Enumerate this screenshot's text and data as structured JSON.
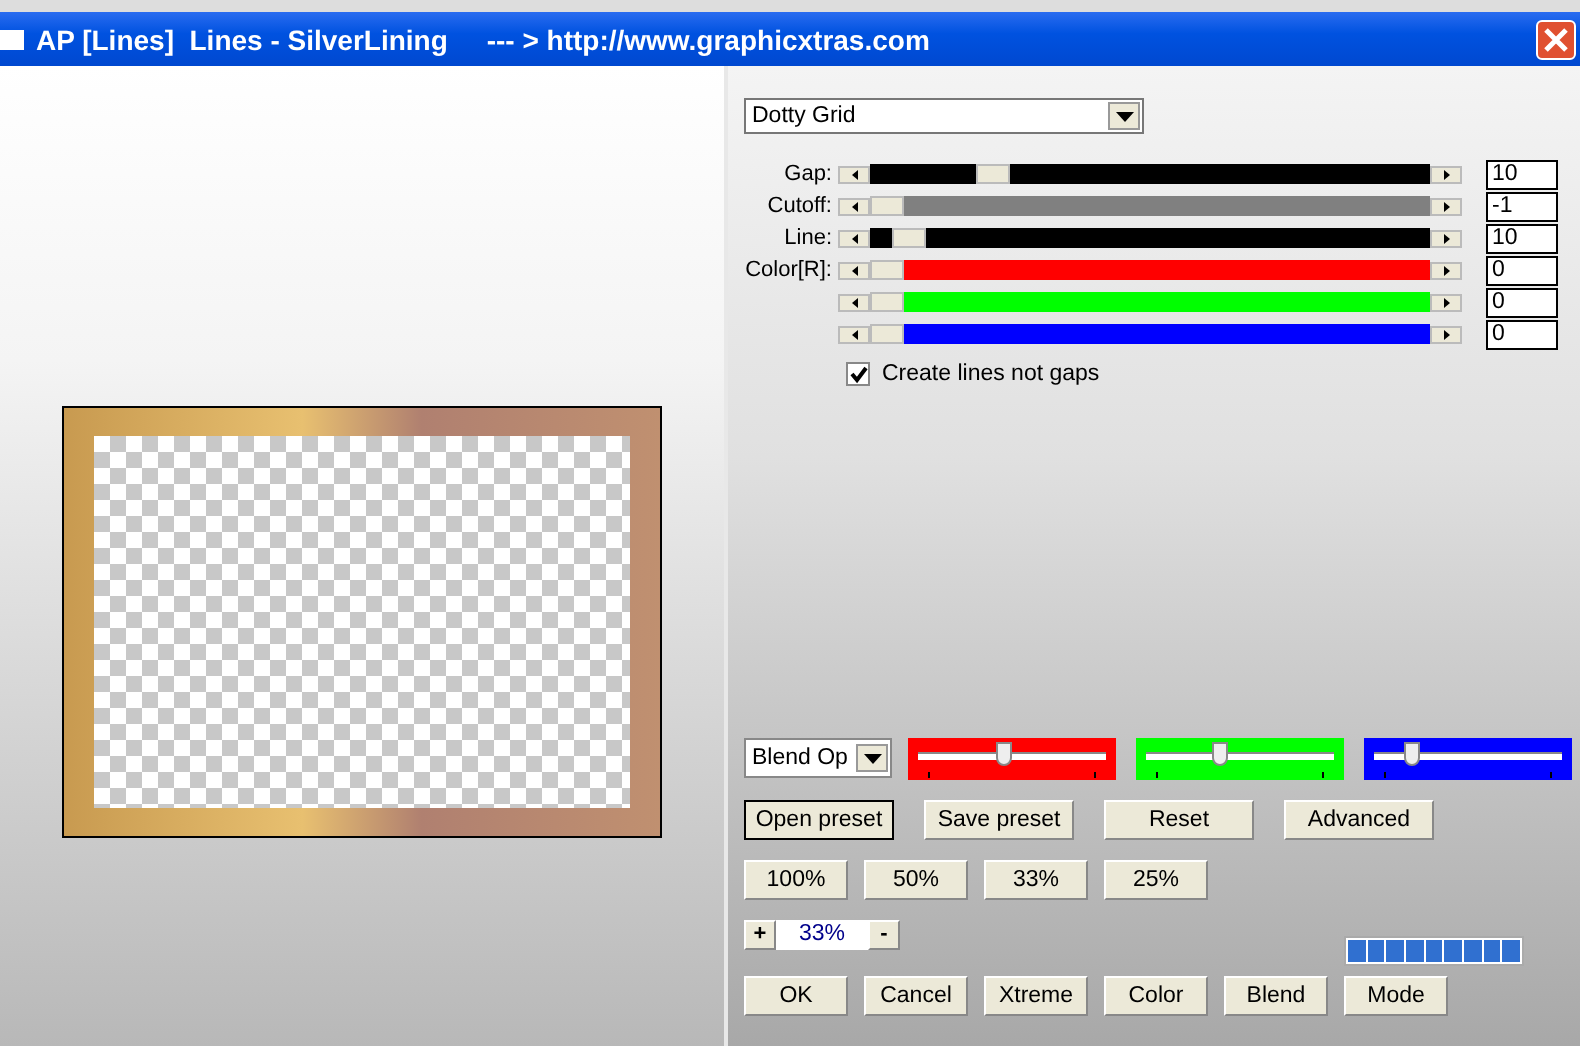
{
  "window": {
    "title": "AP [Lines]  Lines - SilverLining     --- > http://www.graphicxtras.com"
  },
  "effect_dropdown": {
    "value": "Dotty Grid"
  },
  "sliders": [
    {
      "label": "Gap:",
      "level": 0.2,
      "value": "10",
      "color": "#000000"
    },
    {
      "label": "Cutoff:",
      "level": 0,
      "value": "-1",
      "color": "#808080"
    },
    {
      "label": "Line:",
      "level": 0.04,
      "value": "10",
      "color": "#000000"
    },
    {
      "label": "Color[R]:",
      "level": 0,
      "value": "0",
      "color": "#ff0000"
    },
    {
      "level": 0,
      "value": "0",
      "color": "#00ff00"
    },
    {
      "level": 0,
      "value": "0",
      "color": "#0000ff"
    }
  ],
  "checkbox": {
    "label": "Create lines not gaps",
    "checked": true
  },
  "blend_dropdown": {
    "value": "Blend Op"
  },
  "channel_sliders": [
    {
      "color": "#ff0000",
      "level": 0.48
    },
    {
      "color": "#00ff00",
      "level": 0.4
    },
    {
      "color": "#0000ff",
      "level": 0.17
    }
  ],
  "preset_buttons": [
    "Open preset",
    "Save preset",
    "Reset",
    "Advanced"
  ],
  "zoom_buttons": [
    "100%",
    "50%",
    "33%",
    "25%"
  ],
  "zoom": {
    "plus": "+",
    "value": "33%",
    "minus": "-"
  },
  "action_buttons": [
    "OK",
    "Cancel",
    "Xtreme",
    "Color",
    "Blend",
    "Mode"
  ]
}
